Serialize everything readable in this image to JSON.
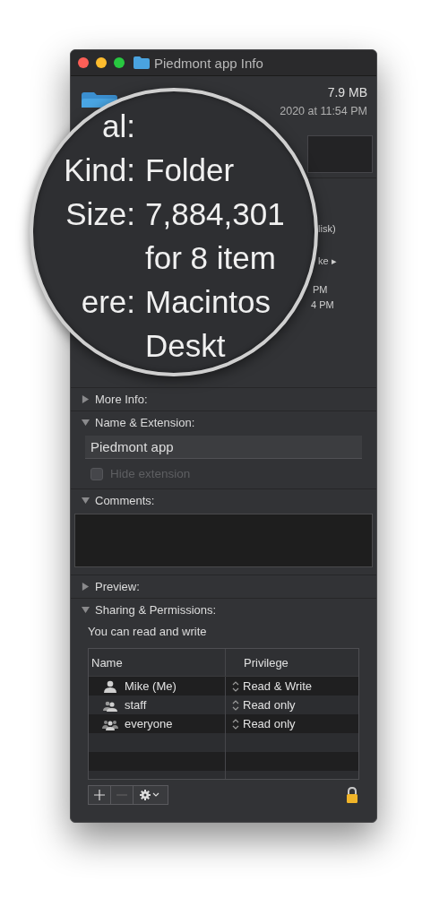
{
  "window": {
    "title": "Piedmont app Info"
  },
  "header": {
    "size": "7.9 MB",
    "modified": "2020 at 11:54 PM"
  },
  "general": {
    "fragments": [
      "lisk)",
      "ke ▸",
      "PM",
      "4 PM"
    ]
  },
  "magnifier": {
    "rows": [
      {
        "label": "al:"
      },
      {
        "label": "Kind:",
        "value": "Folder"
      },
      {
        "label": "Size:",
        "value": "7,884,301"
      },
      {
        "value": "for 8 item"
      },
      {
        "label": "ere:",
        "value": "Macintos"
      },
      {
        "value": "Deskt"
      }
    ]
  },
  "sections": [
    {
      "title": "More Info:",
      "expanded": false
    },
    {
      "title": "Name & Extension:",
      "expanded": true,
      "kind": "name",
      "name_value": "Piedmont app",
      "hide_extension": {
        "label": "Hide extension",
        "checked": false,
        "disabled": true
      }
    },
    {
      "title": "Comments:",
      "expanded": true,
      "kind": "comments"
    },
    {
      "title": "Preview:",
      "expanded": false
    },
    {
      "title": "Sharing & Permissions:",
      "expanded": true,
      "kind": "sharing",
      "summary": "You can read and write",
      "columns": [
        "Name",
        "Privilege"
      ],
      "rows": [
        {
          "name": "Mike (Me)",
          "kind": "user",
          "privilege": "Read & Write"
        },
        {
          "name": "staff",
          "kind": "group",
          "privilege": "Read only"
        },
        {
          "name": "everyone",
          "kind": "everyone",
          "privilege": "Read only"
        }
      ]
    }
  ],
  "lock": {
    "locked": true
  }
}
